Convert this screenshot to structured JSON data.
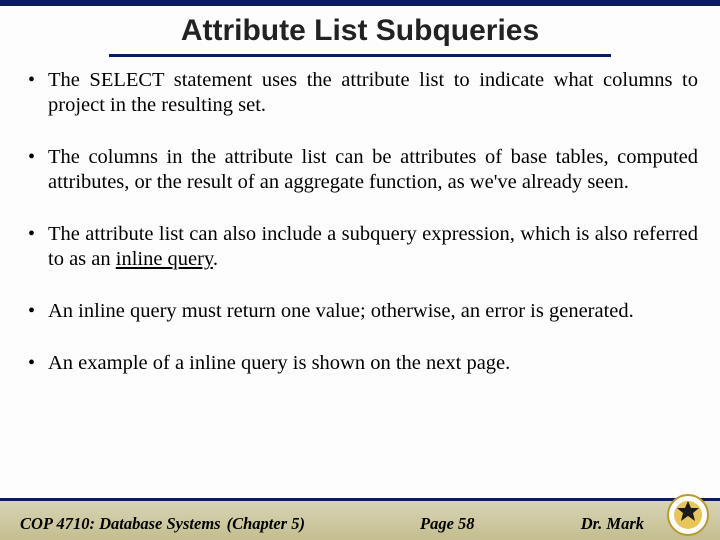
{
  "title": "Attribute List Subqueries",
  "bullets": [
    "The SELECT statement uses the attribute list to indicate what columns to project in the resulting set.",
    "The columns in the attribute list can be attributes of base tables, computed attributes, or the result of an aggregate function, as we've already seen.",
    "The attribute list can also include a subquery expression, which is also referred to as an ",
    "An inline query must return one value; otherwise, an error is generated.",
    "An example of a inline query is shown on the next page."
  ],
  "inline_term": "inline query",
  "inline_suffix": ".",
  "footer": {
    "course": "COP 4710: Database Systems",
    "chapter": "(Chapter 5)",
    "page": "Page 58",
    "author": "Dr. Mark"
  }
}
